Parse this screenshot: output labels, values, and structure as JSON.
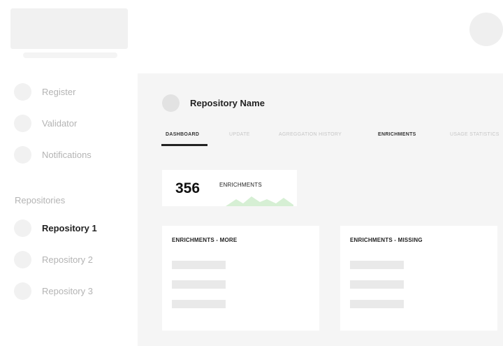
{
  "sidebar": {
    "items": [
      {
        "label": "Register",
        "active": false
      },
      {
        "label": "Validator",
        "active": false
      },
      {
        "label": "Notifications",
        "active": false
      }
    ],
    "section_label": "Repositories",
    "repositories": [
      {
        "label": "Repository 1",
        "active": true
      },
      {
        "label": "Repository 2",
        "active": false
      },
      {
        "label": "Repository 3",
        "active": false
      }
    ]
  },
  "main": {
    "repo_title": "Repository Name",
    "tabs": [
      {
        "label": "DASHBOARD",
        "active": true
      },
      {
        "label": "UPDATE",
        "active": false
      },
      {
        "label": "AGREGGATION HISTORY",
        "active": false
      },
      {
        "label": "ENRICHMENTS",
        "active": false
      },
      {
        "label": "USAGE STATISTICS",
        "active": false
      }
    ],
    "stat": {
      "value": "356",
      "label": "ENRICHMENTS"
    },
    "panels": [
      {
        "title": "ENRICHMENTS - MORE"
      },
      {
        "title": "ENRICHMENTS - MISSING"
      }
    ]
  },
  "colors": {
    "accent_green": "#d6efd4",
    "background": "#f5f5f5",
    "active_text": "#222222",
    "inactive_text": "#b4b4b4"
  }
}
